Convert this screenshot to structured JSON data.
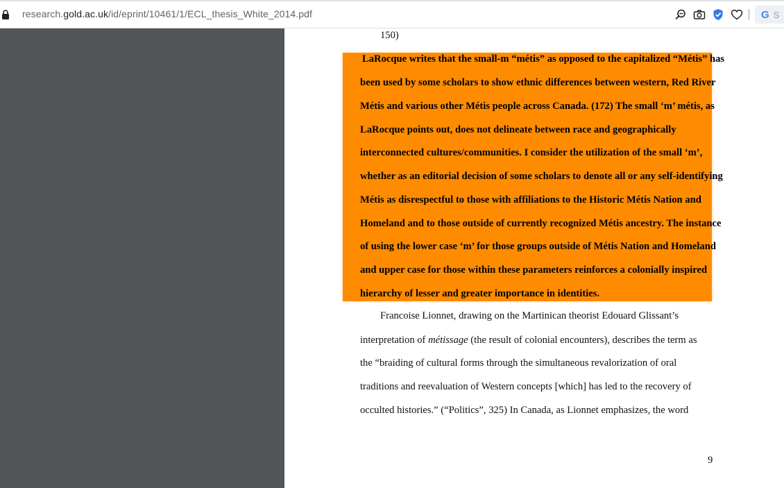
{
  "browser": {
    "url_host_prefix": "research.",
    "url_host": "gold.ac.uk",
    "url_path": "/id/eprint/10461/1/ECL_thesis_White_2014.pdf",
    "search_box_text": "S",
    "icons": [
      "lock-icon",
      "zoom-icon",
      "camera-icon",
      "shield-check-icon",
      "heart-icon",
      "google-icon"
    ]
  },
  "document": {
    "top_fragment": "150)",
    "highlight_color": "#ff8c00",
    "highlighted_lines": [
      " LaRocque writes that the small-m “métis” as opposed to the capitalized “Métis” has",
      "been used by some scholars to show ethnic differences between western, Red River",
      "Métis and various other Métis people across Canada. (172) The small ‘m’ métis, as",
      "LaRocque points out, does not delineate between race and geographically",
      "interconnected cultures/communities. I consider the utilization of the small ‘m’,",
      "whether as an editorial decision of some scholars to denote all or any self-identifying",
      "Métis as disrespectful to those with affiliations to the Historic Métis Nation and",
      "Homeland and to those outside of currently recognized Métis ancestry. The instance",
      "of using the lower case ‘m’ for those groups outside of Métis Nation and Homeland",
      "and upper case for those within these parameters reinforces a colonially inspired",
      "hierarchy of lesser and greater importance in identities."
    ],
    "paragraph": {
      "line1": "Francoise Lionnet, drawing on the Martinican theorist Edouard Glissant’s",
      "line2_before": "interpretation of ",
      "line2_italic": "métissage",
      "line2_after": " (the result of colonial encounters), describes the term as",
      "line3": "the “braiding of cultural forms through the simultaneous revalorization of oral",
      "line4": "traditions and reevaluation of Western concepts [which] has led to the recovery of",
      "line5": "occulted histories.” (“Politics”, 325) In Canada, as Lionnet emphasizes, the word"
    },
    "page_number": "9"
  }
}
